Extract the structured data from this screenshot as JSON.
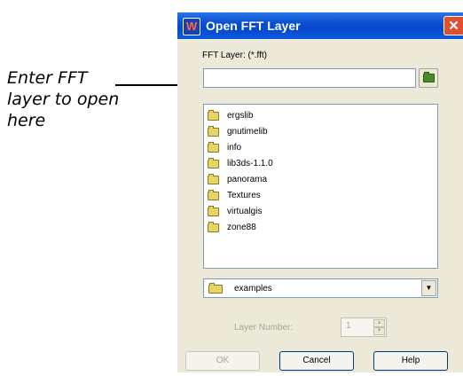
{
  "callout": {
    "line1": "Enter FFT",
    "line2": "layer to open",
    "line3": "here"
  },
  "window": {
    "title": "Open FFT Layer",
    "close_glyph": "✕",
    "app_icon_glyph": "W"
  },
  "fft_layer": {
    "label": "FFT Layer: (*.fft)",
    "value": ""
  },
  "directories": [
    {
      "name": "ergslib"
    },
    {
      "name": "gnutimelib"
    },
    {
      "name": "info"
    },
    {
      "name": "lib3ds-1.1.0"
    },
    {
      "name": "panorama"
    },
    {
      "name": "Textures"
    },
    {
      "name": "virtualgis"
    },
    {
      "name": "zone88"
    }
  ],
  "drive": {
    "selected": "examples",
    "dropdown_glyph": "▼"
  },
  "layer_number": {
    "label": "Layer Number:",
    "value": "1"
  },
  "buttons": {
    "ok": "OK",
    "cancel": "Cancel",
    "help": "Help"
  },
  "icons": {
    "browse": "folder-open-icon",
    "folder": "folder-icon"
  }
}
